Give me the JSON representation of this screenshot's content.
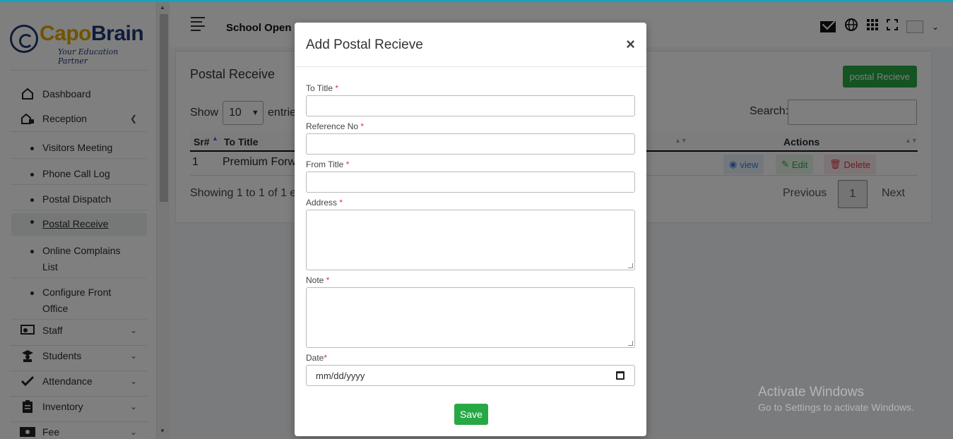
{
  "brand": {
    "name_part1": "Capo",
    "name_part2": "Brain",
    "tagline": "Your Education Partner"
  },
  "sidebar": {
    "items": [
      {
        "label": "Dashboard",
        "icon": "home-icon"
      },
      {
        "label": "Reception",
        "icon": "reception-icon"
      },
      {
        "label": "Staff",
        "icon": "staff-icon"
      },
      {
        "label": "Students",
        "icon": "students-icon"
      },
      {
        "label": "Attendance",
        "icon": "check-icon"
      },
      {
        "label": "Inventory",
        "icon": "clipboard-icon"
      },
      {
        "label": "Fee",
        "icon": "money-icon"
      }
    ],
    "reception_sub": [
      {
        "label": "Visitors Meeting"
      },
      {
        "label": "Phone Call Log"
      },
      {
        "label": "Postal Dispatch"
      },
      {
        "label": "Postal Receive"
      },
      {
        "label": "Online Complains List"
      },
      {
        "label": "Configure Front Office"
      }
    ]
  },
  "header": {
    "school": "School Open"
  },
  "page": {
    "title": "Postal Receive",
    "add_button": "postal Recieve",
    "show_label": "Show",
    "entries_value": "10",
    "entries_label": "entries",
    "search_label": "Search:",
    "columns": {
      "sr": "Sr#",
      "to_title": "To Title",
      "actions": "Actions"
    },
    "rows": [
      {
        "sr": "1",
        "to_title": "Premium Forw"
      }
    ],
    "actions": {
      "view": "view",
      "edit": "Edit",
      "delete": "Delete"
    },
    "showing": "Showing 1 to 1 of 1 e",
    "pagination": {
      "previous": "Previous",
      "current": "1",
      "next": "Next"
    }
  },
  "modal": {
    "title": "Add Postal Recieve",
    "close": "×",
    "fields": {
      "to_title": "To Title",
      "reference_no": "Reference No",
      "from_title": "From Title",
      "address": "Address",
      "note": "Note",
      "date": "Date"
    },
    "required_mark": "*",
    "date_placeholder": "mm/dd/yyyy",
    "save": "Save"
  },
  "watermark": {
    "line1": "Activate Windows",
    "line2": "Go to Settings to activate Windows."
  },
  "colors": {
    "accent": "#28a745",
    "brand_blue": "#1f3b75",
    "brand_gold": "#e0a800",
    "danger": "#dc3545"
  }
}
